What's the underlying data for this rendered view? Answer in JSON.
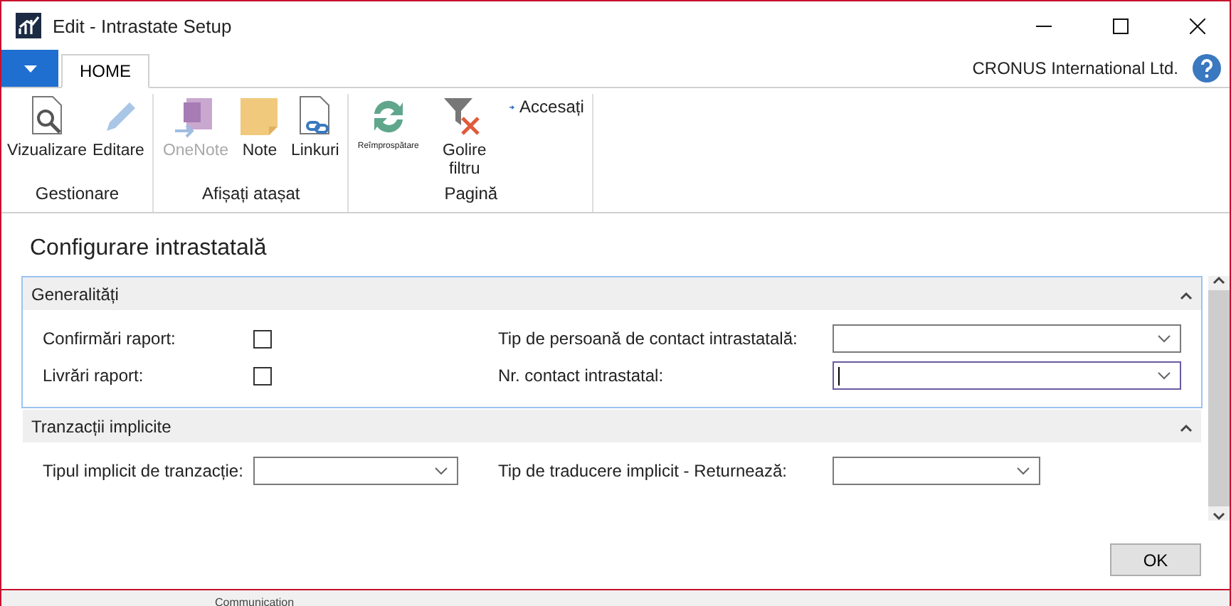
{
  "window": {
    "title": "Edit - Intrastate Setup"
  },
  "ribbon": {
    "tabs": [
      {
        "label": "HOME",
        "selected": true
      }
    ],
    "company": "CRONUS International Ltd.",
    "groups": [
      {
        "title": "Gestionare",
        "actions": [
          {
            "kind": "preview",
            "label": "Vizualizare",
            "disabled": false
          },
          {
            "kind": "edit",
            "label": "Editare",
            "disabled": false
          }
        ]
      },
      {
        "title": "Afișați atașat",
        "actions": [
          {
            "kind": "onenote",
            "label": "OneNote",
            "disabled": true
          },
          {
            "kind": "note",
            "label": "Note",
            "disabled": false
          },
          {
            "kind": "links",
            "label": "Linkuri",
            "disabled": false
          }
        ]
      },
      {
        "title": "Pagină",
        "actions": [
          {
            "kind": "refresh",
            "label": "Reîmprospătare",
            "disabled": false
          },
          {
            "kind": "clearfilter",
            "label": "Golire filtru",
            "disabled": false
          },
          {
            "kind": "goto",
            "label": "Accesați",
            "disabled": false
          }
        ]
      }
    ]
  },
  "page_title": "Configurare intrastatală",
  "sections": [
    {
      "title": "Generalități",
      "expanded": true,
      "focused": true,
      "left": [
        {
          "kind": "checkbox",
          "label": "Confirmări raport:",
          "checked": false
        },
        {
          "kind": "checkbox",
          "label": "Livrări raport:",
          "checked": false
        }
      ],
      "right": [
        {
          "kind": "dropdown",
          "label": "Tip de persoană de contact intrastatală:",
          "focused": false
        },
        {
          "kind": "dropdown",
          "label": "Nr. contact intrastatal:",
          "focused": true
        }
      ]
    },
    {
      "title": "Tranzacții implicite",
      "expanded": true,
      "focused": false,
      "left": [
        {
          "kind": "dropdown",
          "label": "Tipul implicit de tranzacție:",
          "focused": false
        }
      ],
      "right": [
        {
          "kind": "dropdown",
          "label": "Tip de traducere implicit - Returnează:",
          "focused": false
        }
      ]
    }
  ],
  "buttons": [
    "OK"
  ],
  "background_window": {
    "text": "Communication"
  }
}
